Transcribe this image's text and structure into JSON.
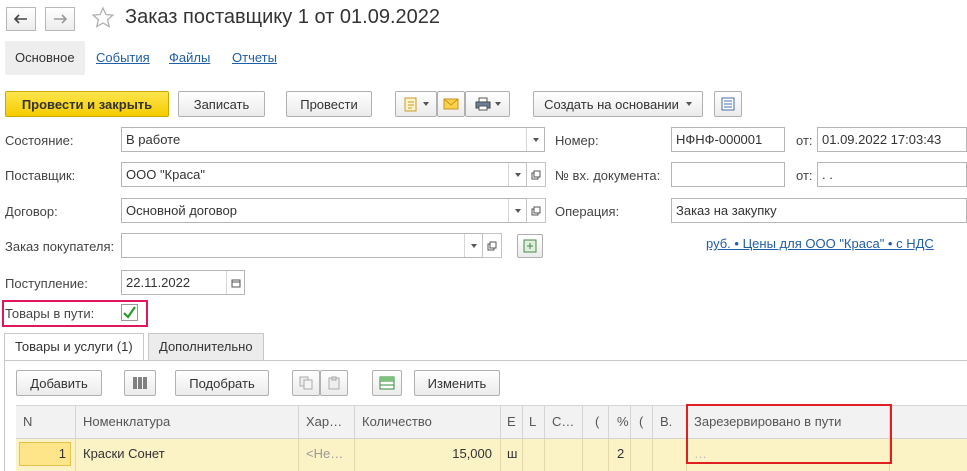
{
  "window": {
    "title": "Заказ поставщику 1 от 01.09.2022"
  },
  "tabs_top": [
    {
      "label": "Основное"
    },
    {
      "label": "События"
    },
    {
      "label": "Файлы"
    },
    {
      "label": "Отчеты"
    }
  ],
  "toolbar": {
    "post_close": "Провести и закрыть",
    "save": "Записать",
    "post": "Провести",
    "create_based": "Создать на основании"
  },
  "form": {
    "state_label": "Состояние:",
    "state_value": "В работе",
    "supplier_label": "Поставщик:",
    "supplier_value": "ООО \"Краса\"",
    "contract_label": "Договор:",
    "contract_value": "Основной договор",
    "customer_order_label": "Заказ покупателя:",
    "customer_order_value": "",
    "arrival_label": "Поступление:",
    "arrival_value": "22.11.2022",
    "in_transit_label": "Товары в пути:",
    "in_transit_checked": true,
    "number_label": "Номер:",
    "number_value": "НФНФ-000001",
    "from_label": "от:",
    "date_value": "01.09.2022 17:03:43",
    "incoming_doc_label": "№ вх. документа:",
    "incoming_doc_value": "",
    "from_label2": "от:",
    "incoming_date_value": " .  .",
    "operation_label": "Операция:",
    "operation_value": "Заказ на закупку",
    "price_link": "руб. • Цены для ООО \"Краса\" • с НДС"
  },
  "inner_tabs": [
    {
      "label": "Товары и услуги (1)"
    },
    {
      "label": "Дополнительно"
    }
  ],
  "table_toolbar": {
    "add": "Добавить",
    "pick": "Подобрать",
    "change": "Изменить"
  },
  "table": {
    "columns": [
      "N",
      "Номенклатура",
      "Хар…",
      "Количество",
      "Е",
      "L",
      "С…",
      "(",
      "%",
      "(",
      "В.",
      "Зарезервировано в пути"
    ],
    "rows": [
      {
        "n": "1",
        "item": "Краски Сонет",
        "char": "<Не…",
        "qty": "15,000",
        "e": "ш",
        "c7": "2",
        "res": "…"
      }
    ]
  },
  "colors": {
    "primary_button": "#f5cc00",
    "link": "#1f5ea8",
    "highlight_pink": "#e0185a",
    "highlight_red": "#e02020",
    "row_selected": "#fbf2c6",
    "check": "#2a9a2a"
  }
}
